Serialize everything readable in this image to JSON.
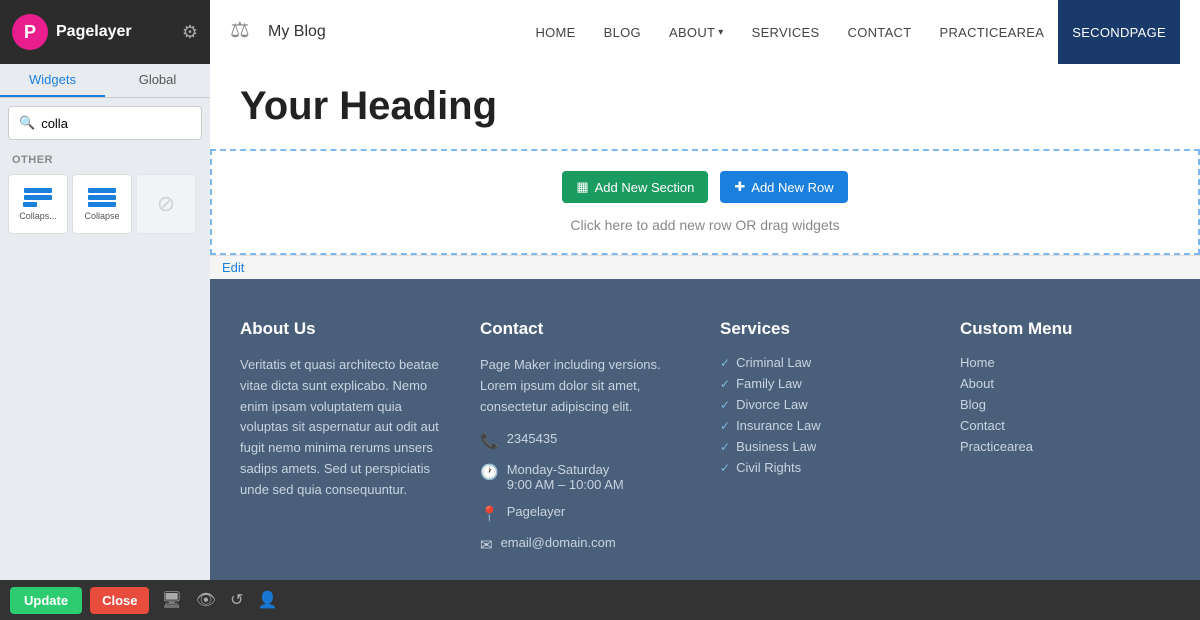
{
  "topbar": {
    "brand": {
      "logo_letter": "P",
      "name": "Pagelayer",
      "gear_icon": "⚙"
    },
    "site": {
      "icon": "⚖",
      "title": "My Blog"
    },
    "nav": {
      "links": [
        {
          "label": "HOME",
          "active": false
        },
        {
          "label": "BLOG",
          "active": false
        },
        {
          "label": "ABOUT",
          "active": false,
          "has_caret": true
        },
        {
          "label": "SERVICES",
          "active": false
        },
        {
          "label": "CONTACT",
          "active": false
        },
        {
          "label": "PRACTICEAREA",
          "active": false
        },
        {
          "label": "SECONDPAGE",
          "active": true
        }
      ]
    }
  },
  "sidebar": {
    "tabs": [
      {
        "label": "Widgets",
        "active": true
      },
      {
        "label": "Global",
        "active": false
      }
    ],
    "search": {
      "placeholder": "colla",
      "value": "colla",
      "clear_icon": "×"
    },
    "section_label": "OTHER",
    "widgets": [
      {
        "label": "Collaps...",
        "type": "collapse1"
      },
      {
        "label": "Collapse",
        "type": "collapse2"
      },
      {
        "label": "",
        "type": "disabled"
      }
    ]
  },
  "page": {
    "heading": "Your Heading",
    "add_section_label": "Add New Section",
    "add_row_label": "Add New Row",
    "drag_hint": "Click here to add new row OR drag widgets",
    "edit_label": "Edit"
  },
  "footer": {
    "about": {
      "title": "About Us",
      "text": "Veritatis et quasi architecto beatae vitae dicta sunt explicabo. Nemo enim ipsam voluptatem quia voluptas sit aspernatur aut odit aut fugit nemo minima rerums unsers sadips amets. Sed ut perspiciatis unde sed quia consequuntur."
    },
    "contact": {
      "title": "Contact",
      "description": "Page Maker including versions. Lorem ipsum dolor sit amet, consectetur adipiscing elit.",
      "phone": "2345435",
      "hours": "Monday-Saturday\n9:00 AM - 10:00 AM",
      "location": "Pagelayer",
      "email": "email@domain.com"
    },
    "services": {
      "title": "Services",
      "items": [
        "Criminal Law",
        "Family Law",
        "Divorce Law",
        "Insurance Law",
        "Business Law",
        "Civil Rights"
      ]
    },
    "custom_menu": {
      "title": "Custom Menu",
      "items": [
        "Home",
        "About",
        "Blog",
        "Contact",
        "Practicearea"
      ]
    }
  },
  "toolbar": {
    "update_label": "Update",
    "close_label": "Close",
    "icons": [
      "🖥",
      "👁",
      "↺",
      "👤"
    ]
  }
}
